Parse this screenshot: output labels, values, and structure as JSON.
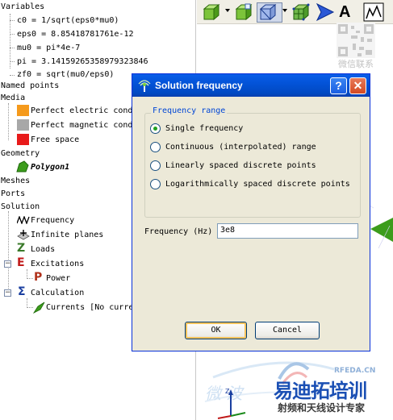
{
  "tree": {
    "variables_header": "Variables",
    "variables": [
      "c0 = 1/sqrt(eps0*mu0)",
      "eps0 = 8.85418781761e-12",
      "mu0 = pi*4e-7",
      "pi = 3.14159265358979323846",
      "zf0 = sqrt(mu0/eps0)"
    ],
    "named_points": "Named points",
    "media_header": "Media",
    "media": [
      {
        "label": "Perfect electric cond",
        "color": "#f59a1c"
      },
      {
        "label": "Perfect magnetic cond",
        "color": "#a8a8a8"
      },
      {
        "label": "Free space",
        "color": "#e81a1a"
      }
    ],
    "geometry_header": "Geometry",
    "geometry_item": "Polygon1",
    "meshes": "Meshes",
    "ports": "Ports",
    "solution_header": "Solution",
    "solution_items": [
      "Frequency",
      "Infinite planes",
      "Loads"
    ],
    "excitations": "Excitations",
    "excitation_child": "Power",
    "calculation": "Calculation",
    "calculation_child": "Currents [No curre"
  },
  "dialog": {
    "title": "Solution frequency",
    "help_button": "?",
    "close_button": "✕",
    "group_title": "Frequency range",
    "options": [
      "Single frequency",
      "Continuous (interpolated) range",
      "Linearly spaced discrete points",
      "Logarithmically spaced discrete points"
    ],
    "selected_option": "Single frequency",
    "frequency_label": "Frequency (Hz)",
    "frequency_value": "3e8",
    "ok_label": "OK",
    "cancel_label": "Cancel"
  },
  "watermark": {
    "qr_caption": "微信联系",
    "logo_top": "RFEDA.CN",
    "logo_main": "易迪拓培训",
    "logo_sub": "射频和天线设计专家",
    "faint_text": "微 波"
  },
  "colors": {
    "xp_title_blue": "#0353d8",
    "close_red": "#e04822",
    "dialog_face": "#ece9d8",
    "group_title_blue": "#0046d5",
    "radio_green": "#21a121",
    "polygon_green": "#3c9c1c"
  }
}
